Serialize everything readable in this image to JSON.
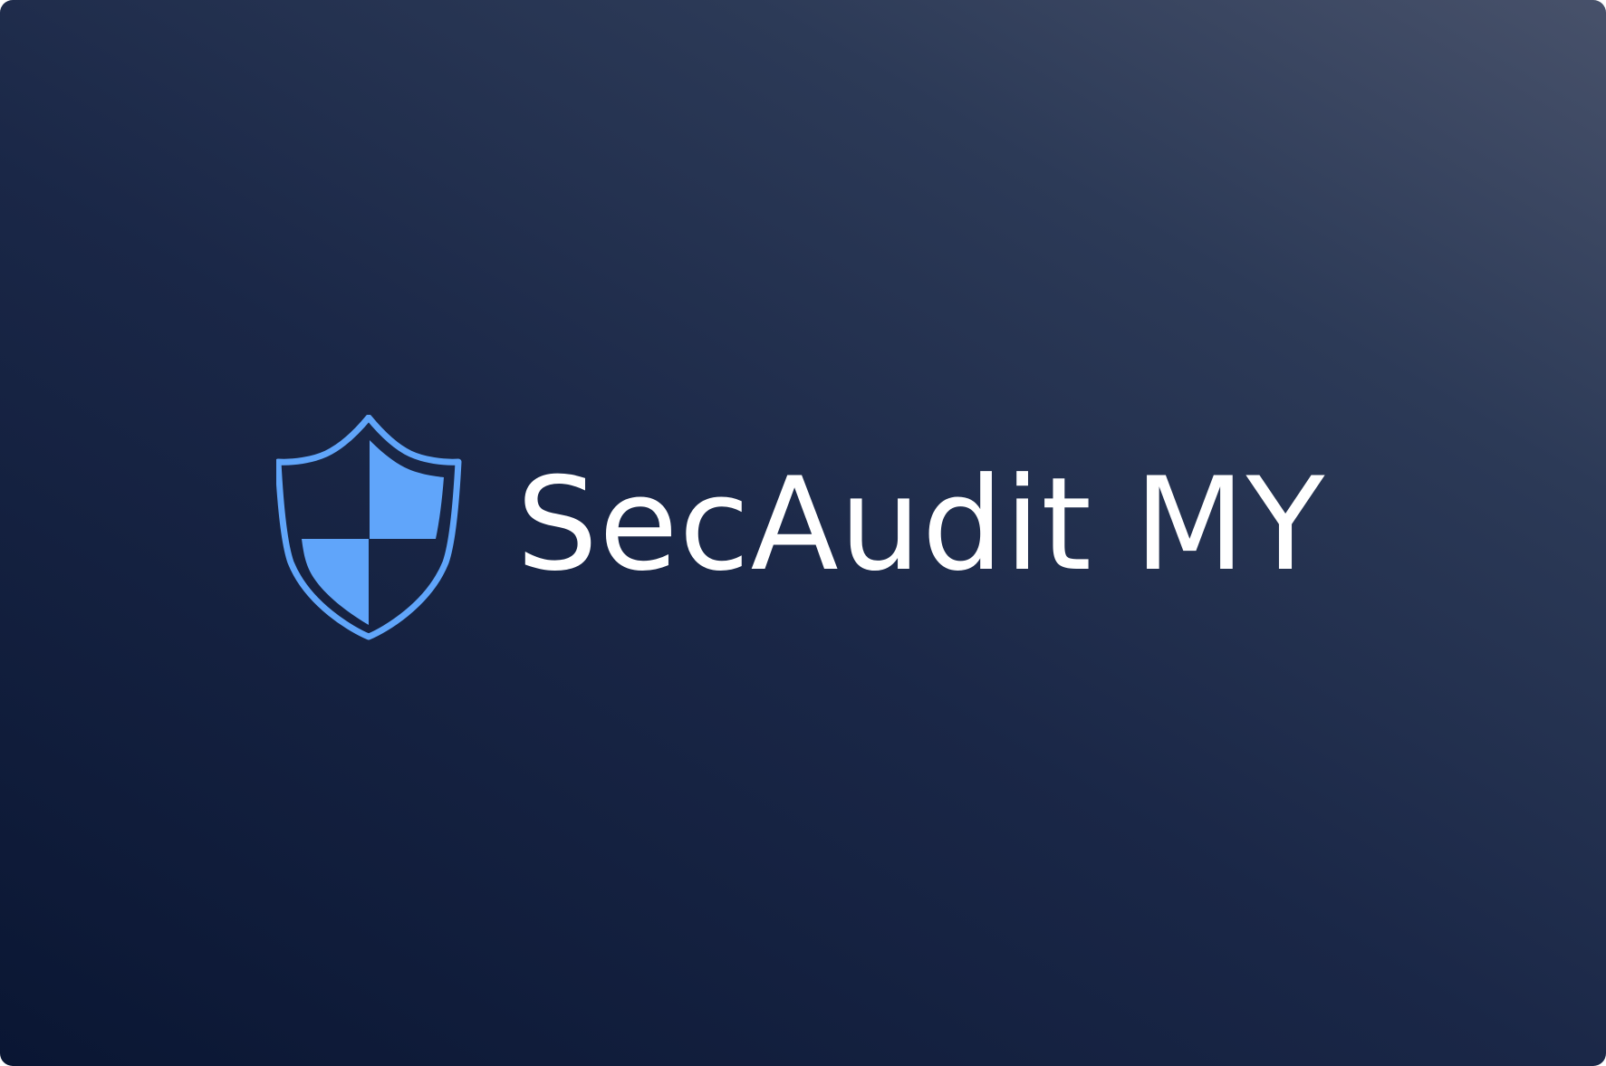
{
  "brand": {
    "name": "SecAudit MY",
    "logo_icon": "shield-icon",
    "accent_color": "#60a5fa",
    "text_color": "#ffffff"
  },
  "background": {
    "gradient_start": "#0a1633",
    "gradient_end": "#47516a"
  }
}
